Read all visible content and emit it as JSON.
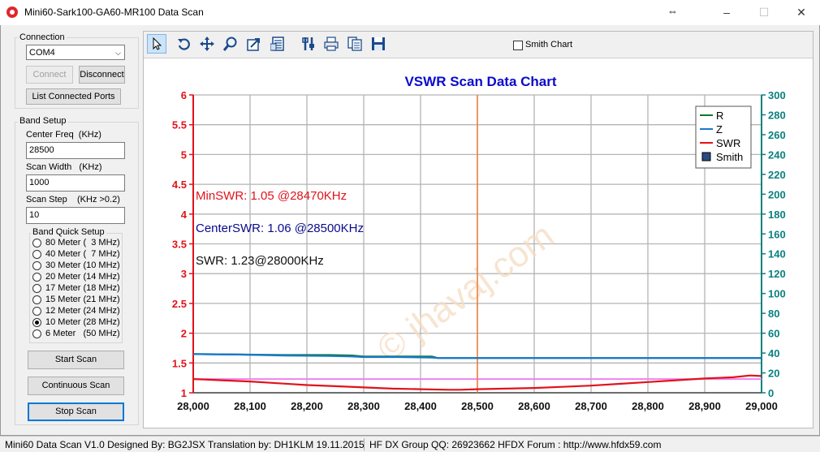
{
  "window": {
    "title": "Mini60-Sark100-GA60-MR100 Data Scan"
  },
  "connection": {
    "group_label": "Connection",
    "port_value": "COM4",
    "connect_label": "Connect",
    "disconnect_label": "Disconnect",
    "list_ports_label": "List Connected Ports"
  },
  "band_setup": {
    "group_label": "Band Setup",
    "center_freq_label": "Center Freq  (KHz)",
    "center_freq_value": "28500",
    "scan_width_label": "Scan Width   (KHz)",
    "scan_width_value": "1000",
    "scan_step_label": "Scan Step",
    "scan_step_hint": "(KHz >0.2)",
    "scan_step_value": "10"
  },
  "band_quick": {
    "group_label": "Band Quick Setup",
    "options": [
      {
        "label": "80 Meter (  3 MHz)",
        "checked": false
      },
      {
        "label": "40 Meter (  7 MHz)",
        "checked": false
      },
      {
        "label": "30 Meter (10 MHz)",
        "checked": false
      },
      {
        "label": "20 Meter (14 MHz)",
        "checked": false
      },
      {
        "label": "17 Meter (18 MHz)",
        "checked": false
      },
      {
        "label": "15 Meter (21 MHz)",
        "checked": false
      },
      {
        "label": "12 Meter (24 MHz)",
        "checked": false
      },
      {
        "label": "10 Meter (28 MHz)",
        "checked": true
      },
      {
        "label": "6 Meter   (50 MHz)",
        "checked": false
      }
    ]
  },
  "actions": {
    "start_scan": "Start Scan",
    "continuous_scan": "Continuous Scan",
    "stop_scan": "Stop Scan"
  },
  "toolbar": {
    "icons": [
      "pointer-icon",
      "undo-icon",
      "pan-icon",
      "zoom-icon",
      "export-icon",
      "properties-icon",
      "tools-icon",
      "print-icon",
      "copy-icon",
      "save-icon"
    ],
    "smith_chart_label": "Smith Chart",
    "smith_chart_checked": false
  },
  "chart_data": {
    "type": "line",
    "title": "VSWR Scan Data Chart",
    "title_color": "#0a0acd",
    "x_ticks": [
      "28,000",
      "28,100",
      "28,200",
      "28,300",
      "28,400",
      "28,500",
      "28,600",
      "28,700",
      "28,800",
      "28,900",
      "29,000"
    ],
    "xlim": [
      28000,
      29000
    ],
    "y_left_ticks": [
      "1",
      "1.5",
      "2",
      "2.5",
      "3",
      "3.5",
      "4",
      "4.5",
      "5",
      "5.5",
      "6"
    ],
    "ylim_left": [
      1,
      6
    ],
    "left_axis_color": "#e0131b",
    "y_right_ticks": [
      "0",
      "20",
      "40",
      "60",
      "80",
      "100",
      "120",
      "140",
      "160",
      "180",
      "200",
      "220",
      "240",
      "260",
      "280",
      "300"
    ],
    "ylim_right": [
      0,
      300
    ],
    "right_axis_color": "#0a8080",
    "grid": true,
    "cursor_x": 28500,
    "cursor_color": "#f07c34",
    "reference_swr": 1.23,
    "reference_color": "#ee82ee",
    "legend_position": "top-right",
    "legend": [
      {
        "name": "R",
        "color": "#0c7a2c",
        "kind": "line"
      },
      {
        "name": "Z",
        "color": "#1a78cc",
        "kind": "line"
      },
      {
        "name": "SWR",
        "color": "#e0131b",
        "kind": "line"
      },
      {
        "name": "Smith",
        "color": "#2a4c80",
        "kind": "box"
      }
    ],
    "series": [
      {
        "name": "R",
        "axis": "right",
        "color": "#0c7a2c",
        "x": [
          28000,
          28080,
          28160,
          28240,
          28280,
          28300,
          28360,
          28420,
          28430,
          28500,
          28600,
          28700,
          28800,
          28900,
          29000
        ],
        "y": [
          39,
          38.5,
          38,
          38,
          37.5,
          36.5,
          36.5,
          36.5,
          35,
          35,
          35,
          35,
          35,
          35,
          35
        ]
      },
      {
        "name": "Z",
        "axis": "right",
        "color": "#1a78cc",
        "x": [
          28000,
          28080,
          28160,
          28240,
          28280,
          28300,
          28360,
          28420,
          28430,
          28500,
          28600,
          28700,
          28800,
          28900,
          29000
        ],
        "y": [
          39,
          38.5,
          37.5,
          37,
          36.5,
          36,
          36,
          35.5,
          35,
          35,
          35,
          35,
          35,
          35,
          35
        ]
      },
      {
        "name": "SWR",
        "axis": "left",
        "color": "#e0131b",
        "x": [
          28000,
          28050,
          28100,
          28150,
          28200,
          28250,
          28300,
          28350,
          28400,
          28450,
          28470,
          28500,
          28550,
          28600,
          28650,
          28700,
          28750,
          28800,
          28850,
          28900,
          28950,
          28980,
          29000
        ],
        "y": [
          1.23,
          1.21,
          1.19,
          1.16,
          1.13,
          1.11,
          1.09,
          1.07,
          1.06,
          1.05,
          1.05,
          1.06,
          1.07,
          1.08,
          1.1,
          1.12,
          1.15,
          1.18,
          1.21,
          1.24,
          1.26,
          1.29,
          1.28
        ]
      }
    ],
    "annotations": [
      {
        "text": "MinSWR: 1.05 @28470KHz",
        "color": "#e0131b"
      },
      {
        "text": "CenterSWR: 1.06 @28500KHz",
        "color": "#0a0a8c"
      },
      {
        "text": "SWR: 1.23@28000KHz",
        "color": "#111111"
      }
    ],
    "watermark": "© jhavaj.com"
  },
  "status": {
    "left": "Mini60 Data Scan V1.0   Designed By: BG2JSX  Translation by: DH1KLM    19.11.2015",
    "right": "HF DX Group QQ: 26923662  HFDX Forum :  http://www.hfdx59.com"
  }
}
